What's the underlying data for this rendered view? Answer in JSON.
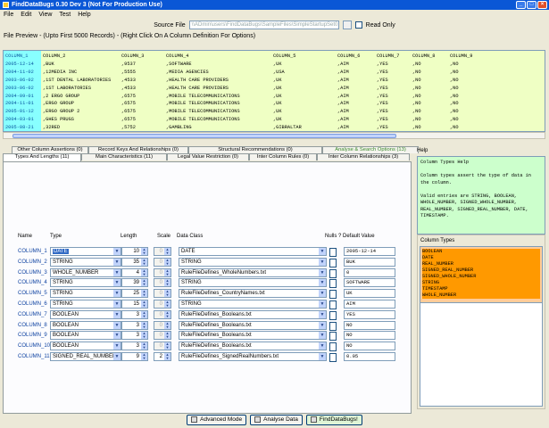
{
  "window": {
    "title": "FindDataBugs 0.30 Dev 3 (Not For Production Use)"
  },
  "menu": [
    "File",
    "Edit",
    "View",
    "Test",
    "Help"
  ],
  "source": {
    "label": "Source File",
    "value": "\\\\ADmin\\users\\FindDataBugs\\SampleFiles\\SimpleStartupSet01.txt",
    "read_only_label": "Read Only"
  },
  "preview": {
    "label": "File Preview - (Upto First 5000 Records) - (Right Click On A Column Definition For Options)",
    "headers": [
      "COLUMN_1",
      "COLUMN_2",
      "COLUMN_3",
      "COLUMN_4",
      "COLUMN_5",
      "COLUMN_6",
      "COLUMN_7",
      "COLUMN_8",
      "COLUMN_9"
    ],
    "rows": [
      [
        "2005-12-14",
        ",BUK",
        ",9537",
        ",SOFTWARE",
        ",UK",
        ",AIM",
        ",YES",
        ",NO",
        ",NO"
      ],
      [
        "2004-11-02",
        ",12MEDIA INC",
        ",5555",
        ",MEDIA AGENCIES",
        ",USA",
        ",AIM",
        ",YES",
        ",NO",
        ",NO"
      ],
      [
        "2003-06-02",
        ",1ST DENTAL LABORATORIES",
        ",4533",
        ",HEALTH CARE PROVIDERS",
        ",UK",
        ",AIM",
        ",YES",
        ",NO",
        ",NO"
      ],
      [
        "2003-06-02",
        ",1ST LABORATORIES",
        ",4533",
        ",HEALTH CARE PROVIDERS",
        ",UK",
        ",AIM",
        ",YES",
        ",NO",
        ",NO"
      ],
      [
        "2004-09-01",
        ",2 ERGO GROUP",
        ",6575",
        ",MOBILE TELECOMMUNICATIONS",
        ",UK",
        ",AIM",
        ",YES",
        ",NO",
        ",NO"
      ],
      [
        "2004-11-01",
        ",ERGO GROUP",
        ",6575",
        ",MOBILE TELECOMMUNICATIONS",
        ",UK",
        ",AIM",
        ",YES",
        ",NO",
        ",NO"
      ],
      [
        "2005-01-12",
        ",ERGO GROUP 2",
        ",6575",
        ",MOBILE TELECOMMUNICATIONS",
        ",UK",
        ",AIM",
        ",YES",
        ",NO",
        ",NO"
      ],
      [
        "2004-03-01",
        ",GHES PRUGS",
        ",6575",
        ",MOBILE TELECOMMUNICATIONS",
        ",UK",
        ",AIM",
        ",YES",
        ",NO",
        ",NO"
      ],
      [
        "2005-08-21",
        ",32RED",
        ",5752",
        ",GAMBLING",
        ",GIBRALTAR",
        ",AIM",
        ",YES",
        ",NO",
        ",NO"
      ]
    ]
  },
  "tabs": {
    "row1": [
      "Other Column Assertions (0)",
      "Record Keys And Relationships (0)",
      "Structural Recommendations (0)",
      "Analyse & Search Options (13)"
    ],
    "row2": [
      "Types And Lengths (11)",
      "Main Characteristics (11)",
      "Legal Value Restriction (0)",
      "Inter Column Rules (0)",
      "Inter Column Relationships (3)"
    ]
  },
  "grid": {
    "headers": {
      "name": "Name",
      "type": "Type",
      "length": "Length",
      "scale": "Scale",
      "data_class": "Data Class",
      "nulls": "Nulls ?",
      "default": "Default Value"
    },
    "rows": [
      {
        "name": "COLUMN_1",
        "type": "DATE",
        "length": "10",
        "scale": "0",
        "data_class": "DATE",
        "default": "2005-12-14"
      },
      {
        "name": "COLUMN_2",
        "type": "STRING",
        "length": "35",
        "scale": "0",
        "data_class": "STRING",
        "default": "BUK"
      },
      {
        "name": "COLUMN_3",
        "type": "WHOLE_NUMBER",
        "length": "4",
        "scale": "0",
        "data_class": "RuleFileDefines_WholeNumbers.txt",
        "default": "0"
      },
      {
        "name": "COLUMN_4",
        "type": "STRING",
        "length": "39",
        "scale": "0",
        "data_class": "STRING",
        "default": "SOFTWARE"
      },
      {
        "name": "COLUMN_5",
        "type": "STRING",
        "length": "25",
        "scale": "0",
        "data_class": "RuleFileDefines_CountryNames.txt",
        "default": "UK"
      },
      {
        "name": "COLUMN_6",
        "type": "STRING",
        "length": "15",
        "scale": "0",
        "data_class": "STRING",
        "default": "AIM"
      },
      {
        "name": "COLUMN_7",
        "type": "BOOLEAN",
        "length": "3",
        "scale": "0",
        "data_class": "RuleFileDefines_Booleans.txt",
        "default": "YES"
      },
      {
        "name": "COLUMN_8",
        "type": "BOOLEAN",
        "length": "3",
        "scale": "0",
        "data_class": "RuleFileDefines_Booleans.txt",
        "default": "NO"
      },
      {
        "name": "COLUMN_9",
        "type": "BOOLEAN",
        "length": "3",
        "scale": "0",
        "data_class": "RuleFileDefines_Booleans.txt",
        "default": "NO"
      },
      {
        "name": "COLUMN_10",
        "type": "BOOLEAN",
        "length": "3",
        "scale": "0",
        "data_class": "RuleFileDefines_Booleans.txt",
        "default": "NO"
      },
      {
        "name": "COLUMN_11",
        "type": "SIGNED_REAL_NUMBER",
        "length": "9",
        "scale": "2",
        "data_class": "RuleFileDefines_SignedRealNumbers.txt",
        "default": "0.05"
      }
    ]
  },
  "help": {
    "label": "Help",
    "text": "Column Types Help\n\nColumn types assert the type of data in the column.\n\nValid entries are STRING, BOOLEAN, WHOLE_NUMBER, SIGNED_WHOLE_NUMBER, REAL_NUMBER, SIGNED_REAL_NUMBER, DATE, TIMESTAMP."
  },
  "column_types": {
    "label": "Column Types",
    "items": [
      "BOOLEAN",
      "DATE",
      "REAL_NUMBER",
      "SIGNED_REAL_NUMBER",
      "SIGNED_WHOLE_NUMBER",
      "STRING",
      "TIMESTAMP",
      "WHOLE_NUMBER"
    ]
  },
  "buttons": {
    "advanced": "Advanced Mode",
    "analyse": "Analyse Data",
    "find": "FindDataBugs!"
  }
}
